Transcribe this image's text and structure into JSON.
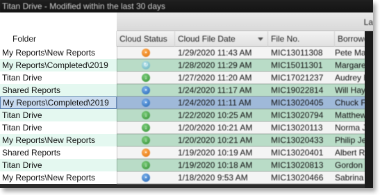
{
  "window": {
    "title": "Titan Drive - Modified within the last 30 days"
  },
  "toolbar": {
    "partial_label": "La"
  },
  "columns": {
    "folder": "Folder",
    "cloud_status": "Cloud Status",
    "cloud_file_date": "Cloud File Date",
    "file_no": "File No.",
    "borrower": "Borrowe"
  },
  "colors": {
    "row_green": "#b5dbc3",
    "row_white_rest": "#ffffff",
    "row_selected": "#9fb9d9",
    "folder_alt": "#e4f8f0",
    "header": "#e6e6e6"
  },
  "rows": [
    {
      "folder": "My Reports\\New Reports",
      "status_icon": "orange-cloud-icon",
      "date": "1/29/2020 11:43 AM",
      "file_no": "MIC13011308",
      "borrower": "Pete Ma"
    },
    {
      "folder": "My Reports\\Completed\\2019",
      "status_icon": "teal-cloud-icon",
      "date": "1/28/2020 11:29 AM",
      "file_no": "MIC15011301",
      "borrower": "Margaret"
    },
    {
      "folder": "Titan Drive",
      "status_icon": "green-arrow-icon",
      "date": "1/27/2020 11:20 AM",
      "file_no": "MIC17021237",
      "borrower": "Audrey H"
    },
    {
      "folder": "Shared Reports",
      "status_icon": "blue-lock-icon",
      "date": "1/24/2020 11:17 AM",
      "file_no": "MIC19022814",
      "borrower": "Will Hayw"
    },
    {
      "folder": "My Reports\\Completed\\2019",
      "status_icon": "blue-lock-icon",
      "date": "1/24/2020 11:11 AM",
      "file_no": "MIC13020405",
      "borrower": "Chuck Fin"
    },
    {
      "folder": "Titan Drive",
      "status_icon": "green-arrow-icon",
      "date": "1/22/2020 10:25 AM",
      "file_no": "MIC13020794",
      "borrower": "Matthew"
    },
    {
      "folder": "Titan Drive",
      "status_icon": "green-arrow-icon",
      "date": "1/20/2020 10:21 AM",
      "file_no": "MIC13020113",
      "borrower": "Norma Je"
    },
    {
      "folder": "My Reports\\New Reports",
      "status_icon": "green-arrow-icon",
      "date": "1/20/2020 10:21 AM",
      "file_no": "MIC13020433",
      "borrower": "Philip Jef"
    },
    {
      "folder": "Shared Reports",
      "status_icon": "orange-lock-icon",
      "date": "1/19/2020 10:19 AM",
      "file_no": "MIC13020401",
      "borrower": "Albert Ro"
    },
    {
      "folder": "Titan Drive",
      "status_icon": "green-arrow-icon",
      "date": "1/19/2020 10:18 AM",
      "file_no": "MIC13020813",
      "borrower": "Gordon G"
    },
    {
      "folder": "My Reports\\New Reports",
      "status_icon": "blue-lock-icon",
      "date": "1/18/2020 9:53 AM",
      "file_no": "MIC13020466",
      "borrower": "Sabrina S"
    }
  ]
}
